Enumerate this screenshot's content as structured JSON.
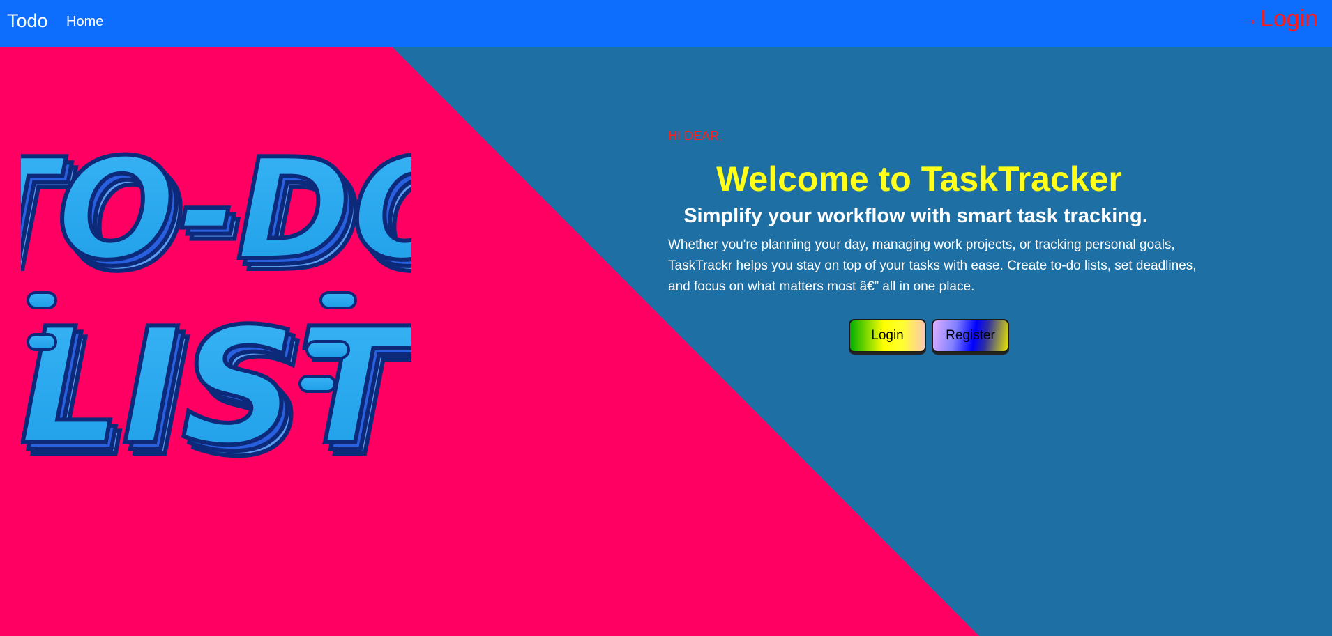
{
  "navbar": {
    "brand": "Todo",
    "home_label": "Home",
    "login_label": "Login",
    "login_icon": "arrow-right-icon",
    "login_arrow": "→"
  },
  "hero": {
    "greeting": "HI DEAR,",
    "title": "Welcome to TaskTracker",
    "subtitle": "Simplify your workflow with smart task tracking.",
    "description": "Whether you're planning your day, managing work projects, or tracking personal goals, TaskTrackr helps you stay on top of your tasks with ease. Create to-do lists, set deadlines, and focus on what matters most â€” all in one place.",
    "login_button": "Login",
    "register_button": "Register"
  },
  "logo": {
    "line1": "TO-DO",
    "line2": "LIST"
  },
  "colors": {
    "navbar_bg": "#0d6efd",
    "left_bg": "#ff0062",
    "right_bg": "#1e6fa4",
    "title": "#ffff1a",
    "greeting": "#ff2020",
    "nav_login": "#ff1a1a"
  }
}
